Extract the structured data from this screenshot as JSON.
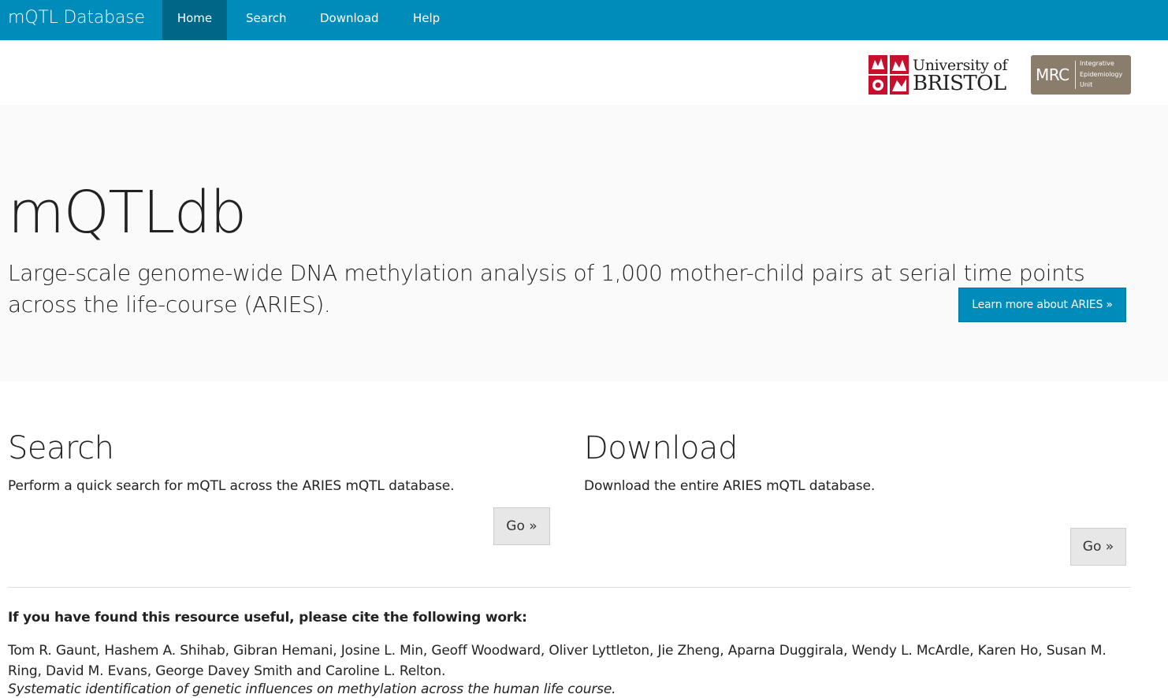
{
  "navbar": {
    "brand": "mQTL Database",
    "items": [
      {
        "label": "Home",
        "active": true
      },
      {
        "label": "Search",
        "active": false
      },
      {
        "label": "Download",
        "active": false
      },
      {
        "label": "Help",
        "active": false
      }
    ],
    "color": "#008cba",
    "active_color": "#006687"
  },
  "logos": {
    "bristol": {
      "line1": "University of",
      "line2": "BRISTOL",
      "crest_color": "#c8102e"
    },
    "mrc": {
      "main": "MRC",
      "sub": [
        "Integrative",
        "Epidemiology",
        "Unit"
      ],
      "color": "#8a7d6b"
    }
  },
  "jumbotron": {
    "title": "mQTLdb",
    "lead": "Large-scale genome-wide DNA methylation analysis of 1,000 mother-child pairs at serial time points across the life-course (ARIES).",
    "button_label": "Learn more about ARIES »"
  },
  "features": {
    "search": {
      "title": "Search",
      "text": "Perform a quick search for mQTL across the ARIES mQTL database.",
      "button_label": "Go »"
    },
    "download": {
      "title": "Download",
      "text": "Download the entire ARIES mQTL database.",
      "button_label": "Go »"
    }
  },
  "citation": {
    "heading": "If you have found this resource useful, please cite the following work:",
    "authors": "Tom R. Gaunt, Hashem A. Shihab, Gibran Hemani, Josine L. Min, Geoff Woodward, Oliver Lyttleton, Jie Zheng, Aparna Duggirala, Wendy L. McArdle, Karen Ho, Susan M. Ring, David M. Evans, George Davey Smith and Caroline L. Relton.",
    "title": "Systematic identification of genetic influences on methylation across the human life course."
  }
}
